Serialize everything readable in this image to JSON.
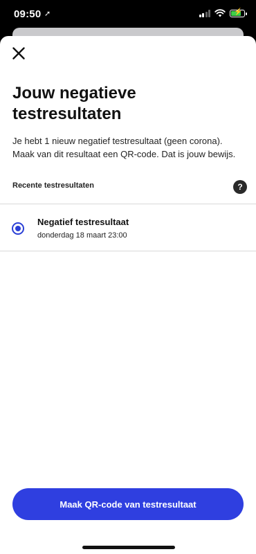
{
  "status_bar": {
    "time": "09:50",
    "location_icon": "location-arrow-icon",
    "signal_icon": "cellular-signal-icon",
    "wifi_icon": "wifi-icon",
    "battery_icon": "battery-charging-icon",
    "battery_level": 0.72,
    "battery_color": "#3ecf4a"
  },
  "sheet": {
    "close_icon": "close-icon",
    "title": "Jouw negatieve testresultaten",
    "intro": "Je hebt 1 nieuw negatief testresultaat (geen corona). Maak van dit resultaat een QR-code. Dat is jouw bewijs.",
    "section_title": "Recente testresultaten",
    "help_label": "?",
    "results": [
      {
        "title": "Negatief testresultaat",
        "date": "donderdag 18 maart 23:00",
        "selected": true
      }
    ],
    "primary_button": "Maak QR-code van testresultaat"
  },
  "colors": {
    "accent": "#2f3fe0",
    "radio": "#2a3fd6"
  }
}
